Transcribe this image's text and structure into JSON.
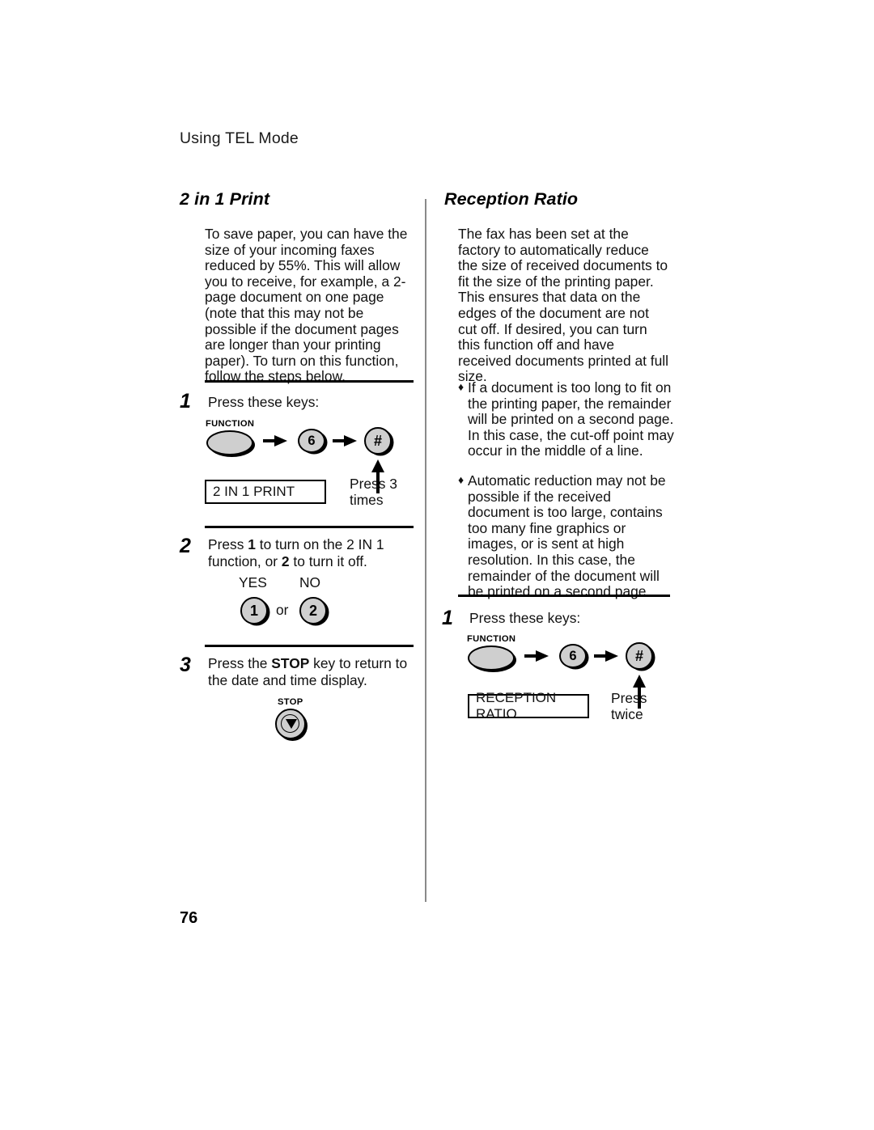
{
  "document": {
    "running_head": "Using TEL Mode",
    "page_number": "76"
  },
  "left_column": {
    "heading": "2 in 1 Print",
    "intro": "To save paper, you can have the size of your incoming faxes reduced by 55%. This will allow you to receive, for example, a 2-page document on one page (note that this may not be possible if the document pages are longer than your printing paper). To turn on this function, follow the steps below.",
    "steps": [
      {
        "number": "1",
        "text": "Press these keys:",
        "function_key_label": "FUNCTION",
        "key_6": "6",
        "key_hash": "#",
        "lcd_text": "2 IN 1 PRINT",
        "press_note_line1": "Press 3",
        "press_note_line2": "times"
      },
      {
        "number": "2",
        "text_part1": "Press ",
        "text_bold1": "1",
        "text_part2": " to turn on the 2 IN 1 function, or ",
        "text_bold2": "2",
        "text_part3": " to turn it off.",
        "yes_label": "YES",
        "no_label": "NO",
        "key_yes": "1",
        "or_label": "or",
        "key_no": "2"
      },
      {
        "number": "3",
        "text_part1": "Press the ",
        "text_bold1": "STOP",
        "text_part2": " key to return to the date and time display.",
        "stop_key_label": "STOP"
      }
    ]
  },
  "right_column": {
    "heading": "Reception Ratio",
    "intro": "The fax has been set at the factory to automatically reduce the size of received documents to fit the size of the printing paper. This ensures that data on the edges of the document are not cut off. If desired, you can turn this function off and have received documents printed at full size.",
    "bullets": [
      {
        "marker": "♦",
        "text": "If a document is too long to fit on the printing paper, the remainder will be printed on a second page. In this case, the cut-off point may occur in the middle of a line."
      },
      {
        "marker": "♦",
        "text": "Automatic reduction may not be possible if the received document is too large, contains too many fine graphics or images, or is sent at high resolution. In this case, the remainder of the document will be printed on a second page."
      }
    ],
    "steps": [
      {
        "number": "1",
        "text": "Press these keys:",
        "function_key_label": "FUNCTION",
        "key_6": "6",
        "key_hash": "#",
        "lcd_text": "RECEPTION RATIO",
        "press_note_line1": "Press",
        "press_note_line2": "twice"
      }
    ]
  },
  "colors": {
    "key_fill": "#cfcfcf",
    "divider": "#8a8a8a",
    "text": "#111111"
  }
}
